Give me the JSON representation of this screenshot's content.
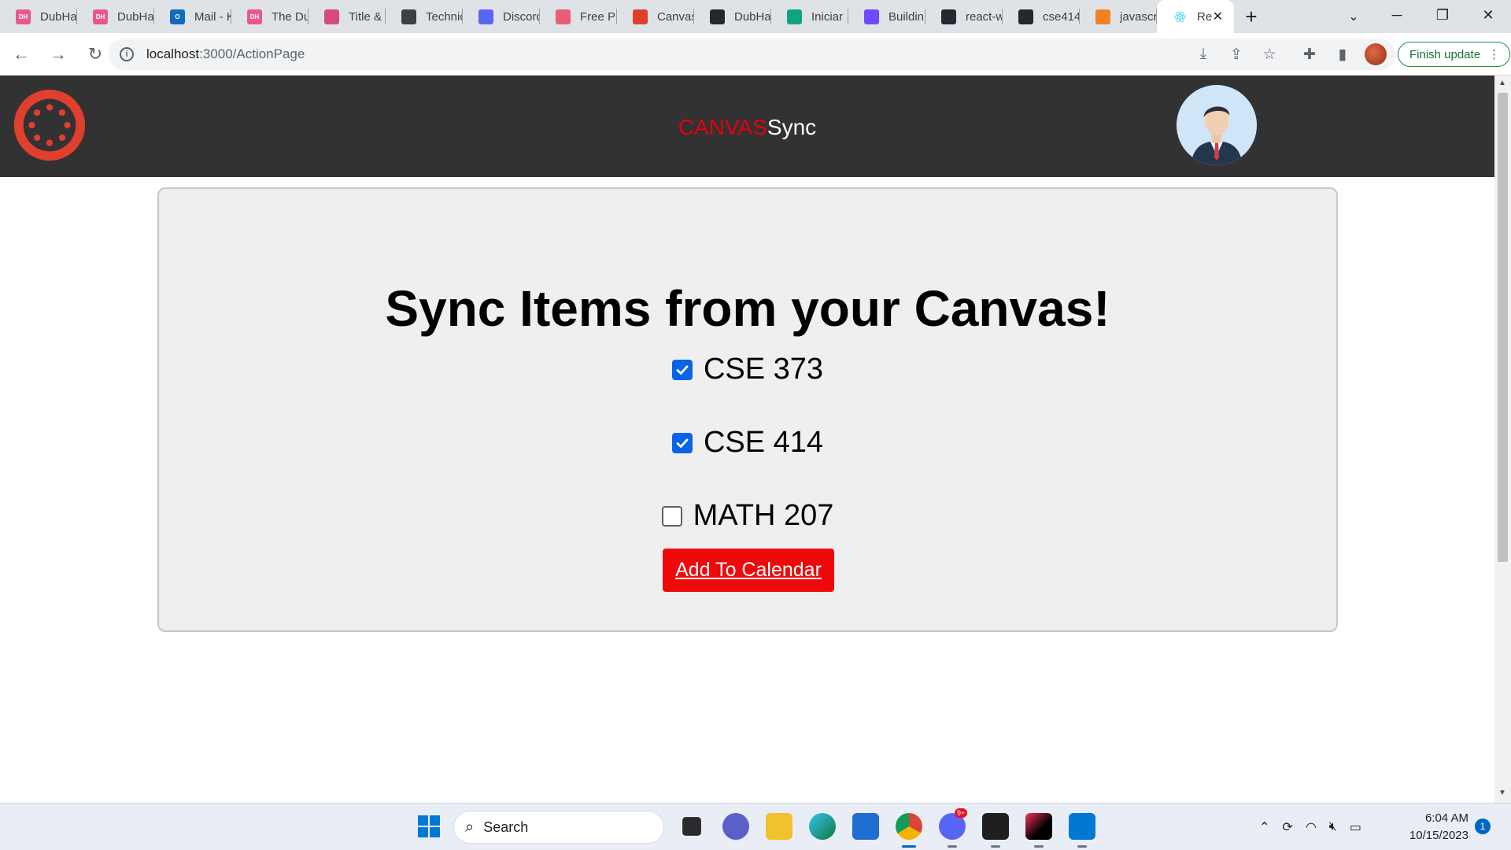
{
  "browser": {
    "tabs": [
      {
        "label": "DubHacks",
        "fav_text": "DH",
        "fav_color": "#e8588f"
      },
      {
        "label": "DubHacks",
        "fav_text": "DH",
        "fav_color": "#e8588f"
      },
      {
        "label": "Mail - K",
        "fav_text": "O",
        "fav_color": "#0f6cbd"
      },
      {
        "label": "The Dub",
        "fav_text": "DH",
        "fav_color": "#e8588f"
      },
      {
        "label": "Title &",
        "fav_text": "",
        "fav_color": "#d64b7c"
      },
      {
        "label": "Technic",
        "fav_text": "",
        "fav_color": "#3c4043"
      },
      {
        "label": "Discord",
        "fav_text": "",
        "fav_color": "#5865f2"
      },
      {
        "label": "Free Pr",
        "fav_text": "",
        "fav_color": "#e85d75"
      },
      {
        "label": "Canvas",
        "fav_text": "",
        "fav_color": "#e13f2e"
      },
      {
        "label": "DubHac",
        "fav_text": "",
        "fav_color": "#24292f"
      },
      {
        "label": "Iniciar",
        "fav_text": "",
        "fav_color": "#10a37f"
      },
      {
        "label": "Buildin",
        "fav_text": "",
        "fav_color": "#6d4aff"
      },
      {
        "label": "react-w",
        "fav_text": "",
        "fav_color": "#24292f"
      },
      {
        "label": "cse414",
        "fav_text": "",
        "fav_color": "#24292f"
      },
      {
        "label": "javascr",
        "fav_text": "",
        "fav_color": "#f48024"
      }
    ],
    "active_tab": {
      "label": "Re",
      "fav_color": "#20232a"
    },
    "url_host": "localhost",
    "url_rest": ":3000/ActionPage",
    "finish_update_label": "Finish update"
  },
  "app": {
    "brand_part1": "CANVAS",
    "brand_part2": "Sync",
    "brand_color": "#e3000f",
    "header_bg": "#323232"
  },
  "main": {
    "title": "Sync Items from your Canvas!",
    "courses": [
      {
        "label": "CSE 373",
        "checked": true
      },
      {
        "label": "CSE 414",
        "checked": true
      },
      {
        "label": "MATH 207",
        "checked": false
      }
    ],
    "add_button_label": "Add To Calendar",
    "add_button_color": "#ee0a0a"
  },
  "taskbar": {
    "search_label": "Search",
    "time": "6:04 AM",
    "date": "10/15/2023",
    "notification_count": "1",
    "discord_badge": "9+"
  }
}
